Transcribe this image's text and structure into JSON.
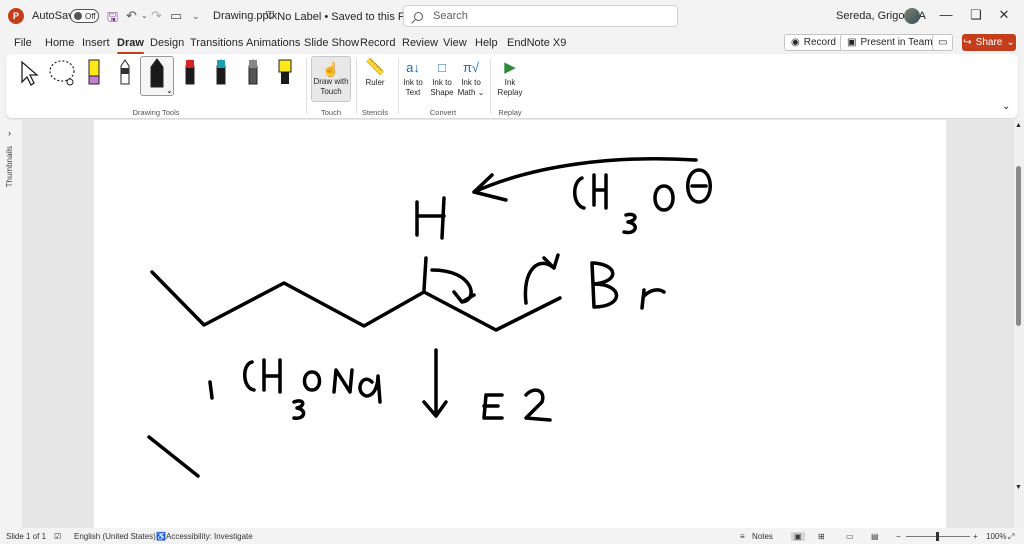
{
  "titlebar": {
    "app_logo": "P",
    "autosave_label": "AutoSave",
    "autosave_state": "Off",
    "filename": "Drawing.pptx",
    "label_status": "No Label • Saved to this PC ⌄",
    "search_placeholder": "Search",
    "user_name": "Sereda, Grigoriy A"
  },
  "menu": {
    "tabs": [
      "File",
      "Home",
      "Insert",
      "Draw",
      "Design",
      "Transitions",
      "Animations",
      "Slide Show",
      "Record",
      "Review",
      "View",
      "Help",
      "EndNote X9"
    ],
    "active_tab": "Draw",
    "record_label": "Record",
    "present_label": "Present in Teams",
    "share_label": "Share"
  },
  "ribbon": {
    "groups": {
      "drawing_tools": "Drawing Tools",
      "touch": "Touch",
      "stencils": "Stencils",
      "convert": "Convert",
      "replay": "Replay"
    },
    "draw_with_touch_1": "Draw with",
    "draw_with_touch_2": "Touch",
    "ruler": "Ruler",
    "ink_to_text_1": "Ink to",
    "ink_to_text_2": "Text",
    "ink_to_shape_1": "Ink to",
    "ink_to_shape_2": "Shape",
    "ink_to_math_1": "Ink to",
    "ink_to_math_2": "Math ⌄",
    "ink_replay_1": "Ink",
    "ink_replay_2": "Replay",
    "pen_colors": [
      "#a9d9f5",
      "#ffffff",
      "#1a1a1a",
      "#d62424",
      "#1a6fb5",
      "#555555",
      "#ffe81a"
    ]
  },
  "leftpane": {
    "thumbnails_label": "Thumbnails"
  },
  "statusbar": {
    "slide_info": "Slide 1 of 1",
    "language": "English (United States)",
    "accessibility": "Accessibility: Investigate",
    "notes": "Notes",
    "zoom": "100%"
  }
}
